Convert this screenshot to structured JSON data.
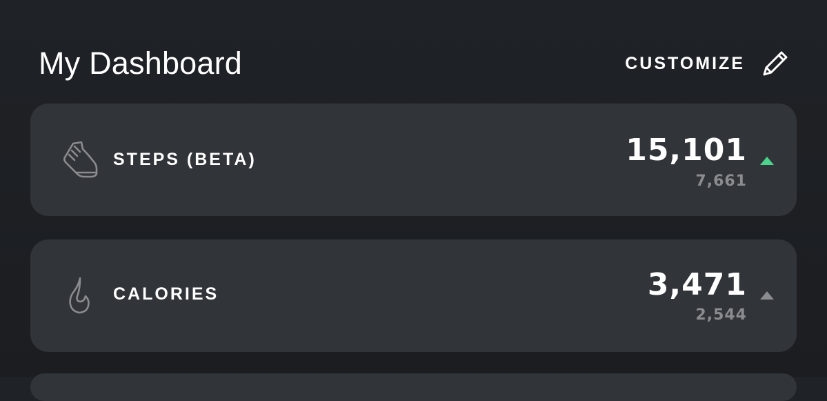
{
  "header": {
    "title": "My Dashboard",
    "customize_label": "CUSTOMIZE",
    "customize_icon": "pencil-icon"
  },
  "cards": [
    {
      "icon": "shoe-icon",
      "label": "STEPS (BETA)",
      "value": "15,101",
      "sub_value": "7,661",
      "trend": "up",
      "trend_color": "#4cd38c"
    },
    {
      "icon": "flame-icon",
      "label": "CALORIES",
      "value": "3,471",
      "sub_value": "2,544",
      "trend": "up",
      "trend_color": "#8a8c8f"
    }
  ],
  "colors": {
    "background": "#1d2024",
    "card": "#313438",
    "text": "#ffffff",
    "muted": "#8a8c8f",
    "accent_green": "#4cd38c"
  }
}
